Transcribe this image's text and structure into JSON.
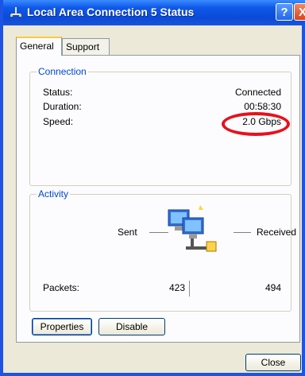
{
  "window": {
    "title": "Local Area Connection 5 Status",
    "help_label": "?",
    "close_label": "X"
  },
  "tabs": [
    {
      "label": "General"
    },
    {
      "label": "Support"
    }
  ],
  "connection": {
    "group_title": "Connection",
    "status_label": "Status:",
    "status_value": "Connected",
    "duration_label": "Duration:",
    "duration_value": "00:58:30",
    "speed_label": "Speed:",
    "speed_value": "2.0 Gbps"
  },
  "activity": {
    "group_title": "Activity",
    "sent_label": "Sent",
    "received_label": "Received",
    "packets_label": "Packets:",
    "packets_sent": "423",
    "packets_received": "494"
  },
  "buttons": {
    "properties": "Properties",
    "disable": "Disable",
    "close": "Close"
  },
  "colors": {
    "accent": "#0046d5",
    "highlight_ring": "#e8101c",
    "titlebar": "#0a4ad8"
  }
}
